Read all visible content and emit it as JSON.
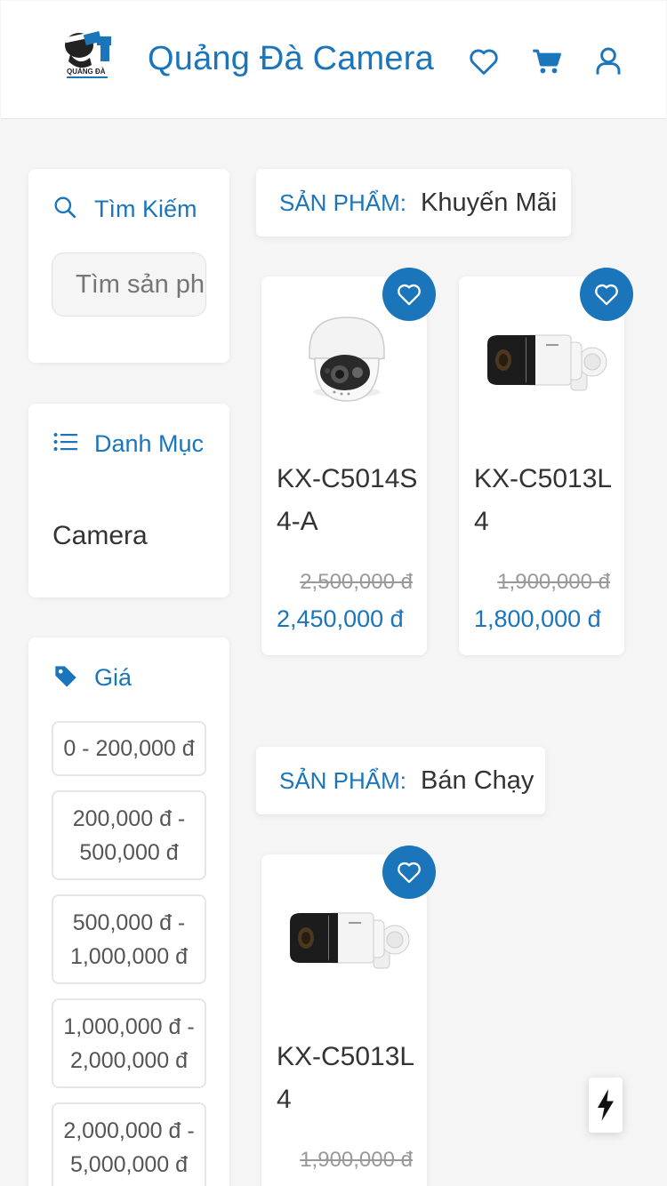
{
  "header": {
    "brand": "Quảng Đà Camera",
    "logo_text": "QUẢNG ĐÀ",
    "icons": [
      "heart-icon",
      "cart-icon",
      "user-icon"
    ],
    "accent": "#1a75bb"
  },
  "search": {
    "title": "Tìm Kiếm",
    "placeholder": "Tìm sản phẩm"
  },
  "category": {
    "title": "Danh Mục",
    "items": [
      "Camera"
    ]
  },
  "price": {
    "title": "Giá",
    "ranges": [
      "0 - 200,000 đ",
      "200,000 đ - 500,000 đ",
      "500,000 đ - 1,000,000 đ",
      "1,000,000 đ - 2,000,000 đ",
      "2,000,000 đ - 5,000,000 đ"
    ]
  },
  "sections": [
    {
      "prefix": "SẢN PHẨM:",
      "name": "Khuyến Mãi",
      "products": [
        {
          "name": "KX-C5014S4-A",
          "old_price": "2,500,000 đ",
          "price": "2,450,000 đ",
          "image": "dome-camera"
        },
        {
          "name": "KX-C5013L4",
          "old_price": "1,900,000 đ",
          "price": "1,800,000 đ",
          "image": "bullet-camera"
        }
      ]
    },
    {
      "prefix": "SẢN PHẨM:",
      "name": "Bán Chạy",
      "products": [
        {
          "name": "KX-C5013L4",
          "old_price": "1,900,000 đ",
          "price": "",
          "image": "bullet-camera"
        }
      ]
    }
  ]
}
